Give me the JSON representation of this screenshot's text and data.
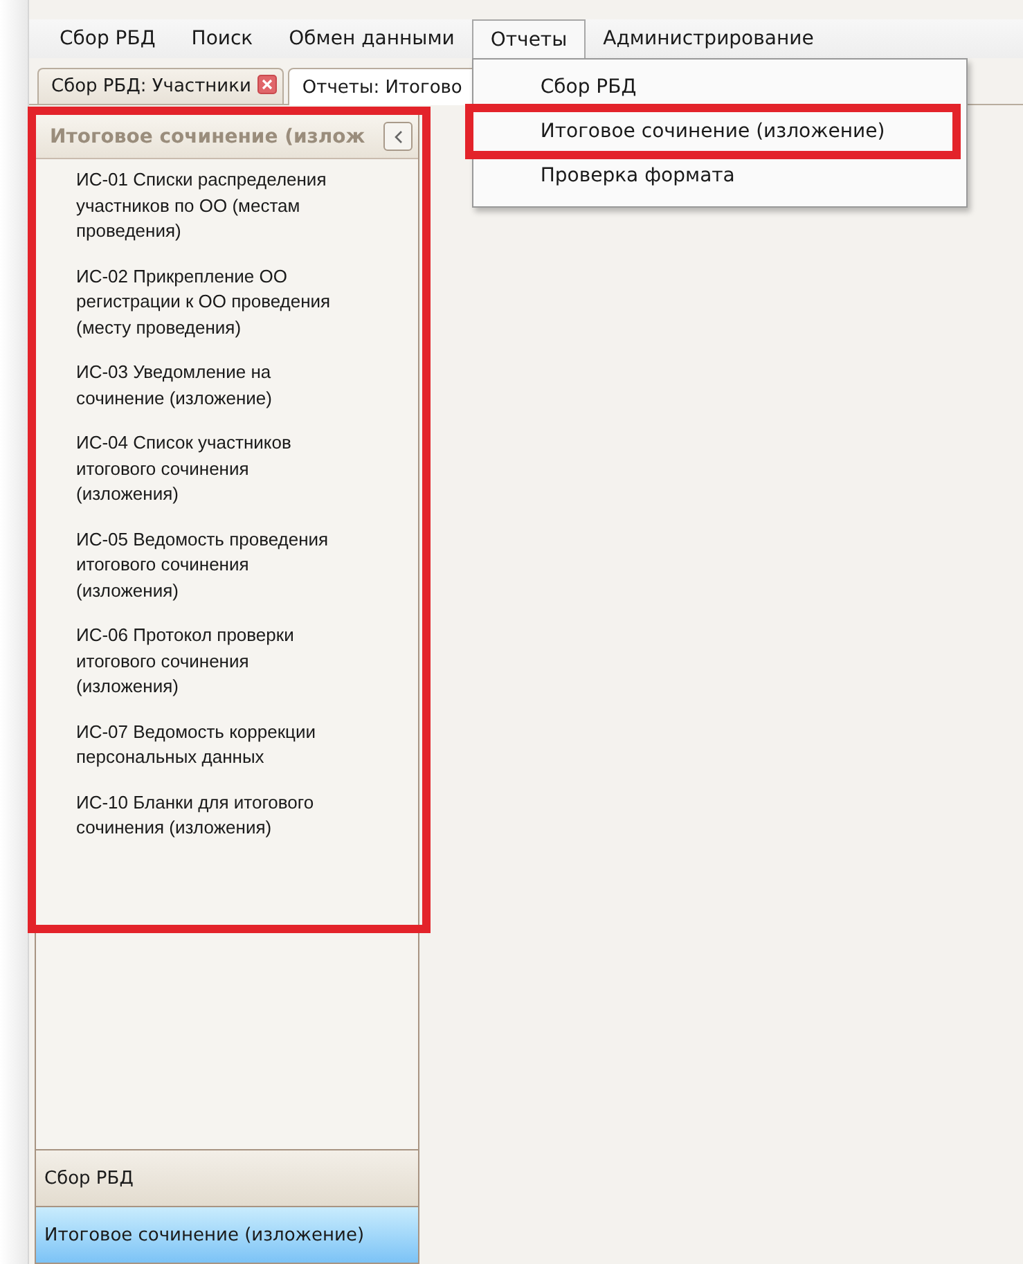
{
  "menu_bar": [
    {
      "label": "Сбор РБД",
      "open": false
    },
    {
      "label": "Поиск",
      "open": false
    },
    {
      "label": "Обмен данными",
      "open": false
    },
    {
      "label": "Отчеты",
      "open": true
    },
    {
      "label": "Администрирование",
      "open": false
    }
  ],
  "dropdown": {
    "items": [
      {
        "label": "Сбор РБД",
        "highlighted": false
      },
      {
        "label": "Итоговое сочинение (изложение)",
        "highlighted": true
      },
      {
        "label": "Проверка формата",
        "highlighted": false
      }
    ]
  },
  "tabs": [
    {
      "label": "Сбор РБД: Участники",
      "selected": false,
      "closable": true
    },
    {
      "label": "Отчеты: Итогово",
      "selected": true,
      "closable": false
    }
  ],
  "side_panel": {
    "title": "Итоговое сочинение (излож",
    "highlighted": true,
    "items": [
      "ИС-01 Списки распределения участников по ОО (местам проведения)",
      "ИС-02 Прикрепление ОО регистрации к ОО проведения (месту проведения)",
      "ИС-03 Уведомление на сочинение (изложение)",
      "ИС-04 Список участников итогового сочинения (изложения)",
      "ИС-05 Ведомость проведения итогового сочинения (изложения)",
      "ИС-06 Протокол проверки итогового сочинения (изложения)",
      "ИС-07 Ведомость коррекции персональных данных",
      "ИС-10 Бланки для итогового сочинения (изложения)"
    ],
    "sections": [
      {
        "label": "Сбор РБД",
        "selected": false
      },
      {
        "label": "Итоговое сочинение (изложение)",
        "selected": true
      }
    ]
  }
}
